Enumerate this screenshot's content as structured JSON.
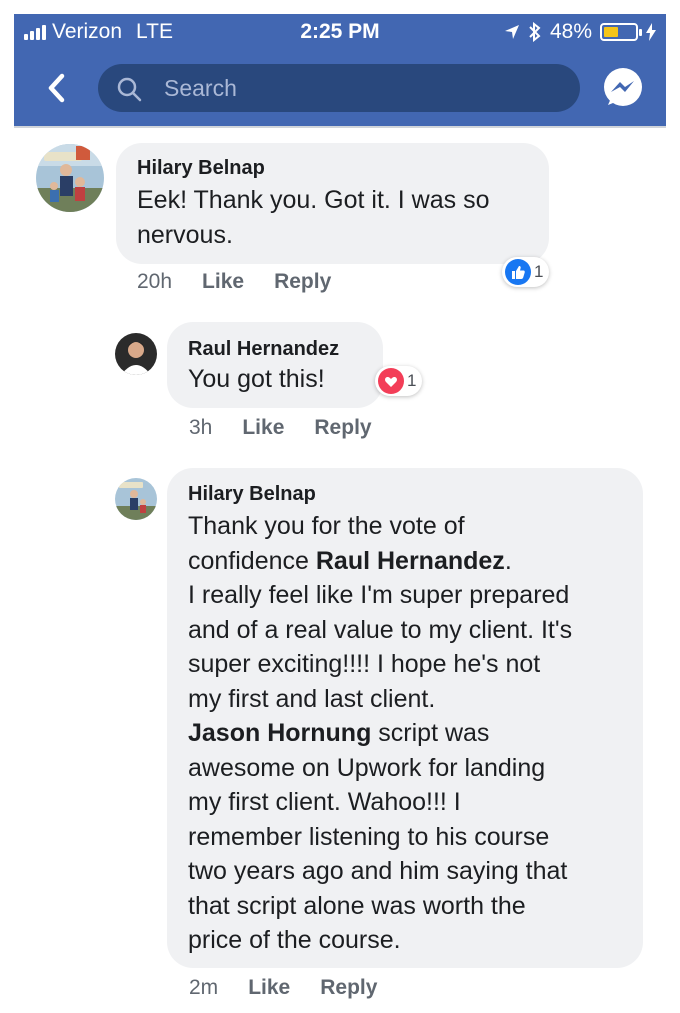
{
  "status_bar": {
    "carrier": "Verizon",
    "network": "LTE",
    "time": "2:25 PM",
    "battery": "48%",
    "battery_level": 0.48
  },
  "nav": {
    "search_placeholder": "Search"
  },
  "colors": {
    "brand": "#4267b2",
    "search_bg": "#29487d",
    "bubble": "#f0f1f3",
    "like_blue": "#1877f2",
    "love_red": "#f33e58"
  },
  "comments": [
    {
      "author": "Hilary Belnap",
      "text_lines": [
        "Eek! Thank you. Got it. I was so",
        "nervous."
      ],
      "time": "20h",
      "like_label": "Like",
      "reply_label": "Reply",
      "reaction": {
        "icon": "thumbs-up-icon",
        "count": "1"
      }
    },
    {
      "author": "Raul Hernandez",
      "text": "You got this!",
      "time": "3h",
      "like_label": "Like",
      "reply_label": "Reply",
      "reaction": {
        "icon": "heart-icon",
        "count": "1"
      }
    },
    {
      "author": "Hilary Belnap",
      "p1_line1": "Thank you for the vote of",
      "p1_line2_pre": "confidence ",
      "p1_mention": "Raul Hernandez",
      "p1_line2_post": ".",
      "lines_a": [
        "I really feel like I'm super prepared",
        "and of a real value to my client. It's",
        "super exciting!!!! I hope he's not",
        "my first and last client."
      ],
      "p2_mention": "Jason Hornung",
      "p2_line1_post": " script was",
      "lines_b": [
        "awesome on Upwork for landing",
        "my first client. Wahoo!!! I",
        "remember listening to his course",
        "two years ago and him saying that",
        "that script alone was worth the",
        "price of the course."
      ],
      "time": "2m",
      "like_label": "Like",
      "reply_label": "Reply"
    }
  ]
}
